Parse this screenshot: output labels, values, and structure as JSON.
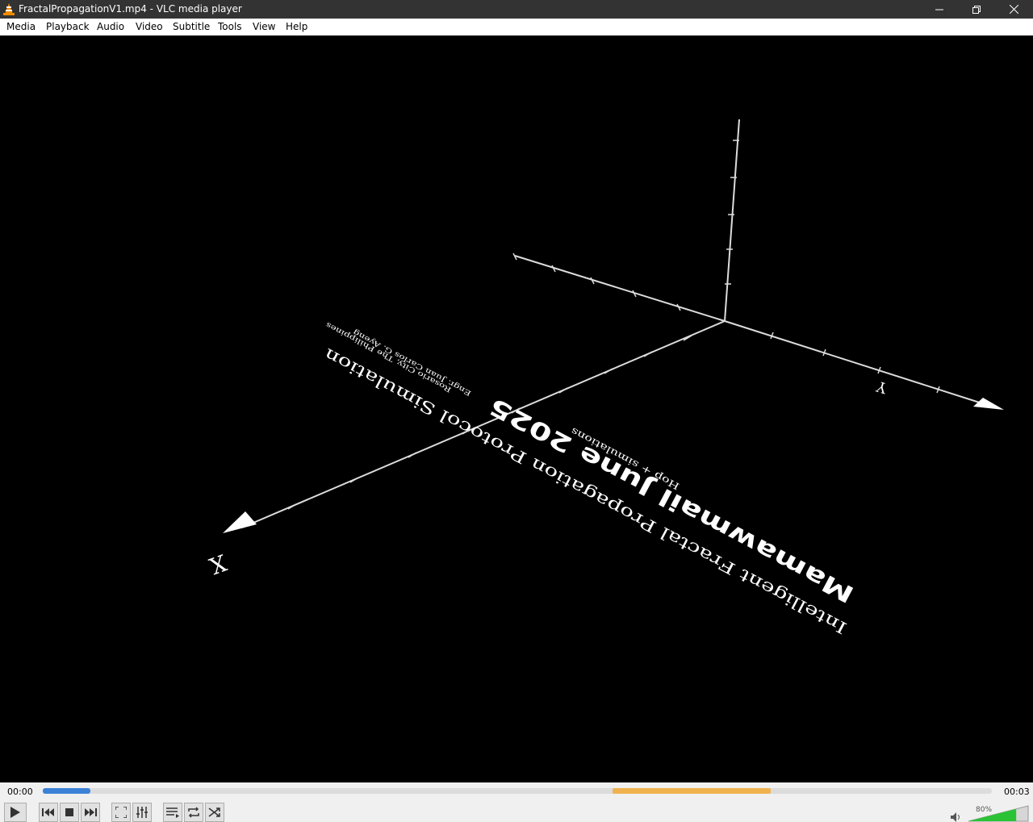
{
  "window": {
    "title": "FractalPropagationV1.mp4 - VLC media player",
    "icon": "vlc-cone-icon",
    "buttons": [
      "minimize-icon",
      "restore-icon",
      "close-icon"
    ]
  },
  "menu": {
    "items": [
      {
        "label": "Media"
      },
      {
        "label": "Playback"
      },
      {
        "label": "Audio"
      },
      {
        "label": "Video"
      },
      {
        "label": "Subtitle"
      },
      {
        "label": "Tools"
      },
      {
        "label": "View"
      },
      {
        "label": "Help"
      }
    ]
  },
  "video": {
    "axis_x_label": "X",
    "axis_y_label": "Y",
    "title_main": "Mamawmail June 2025",
    "title_sub": "Intelligent Fractal Propagation Protocol Simulation",
    "title_small": "Hop + simulations",
    "credit_line1": "Engr. Juan Carlos G. Ayeng",
    "credit_line2": "Rosario City, The Philippines"
  },
  "controls": {
    "time_elapsed": "00:00",
    "time_total": "00:03",
    "progress": 0.05,
    "volume_label": "80%",
    "volume": 0.8,
    "buttons": [
      "play-icon",
      "previous-icon",
      "stop-icon",
      "next-icon",
      "fullscreen-icon",
      "extended-settings-icon",
      "playlist-icon",
      "loop-icon",
      "shuffle-icon",
      "speaker-icon"
    ]
  },
  "colors": {
    "titlebar": "#333333",
    "seek_fill": "#3b82d6",
    "seek_buffer": "#f0b24f",
    "volume_fill": "#2cc236"
  }
}
